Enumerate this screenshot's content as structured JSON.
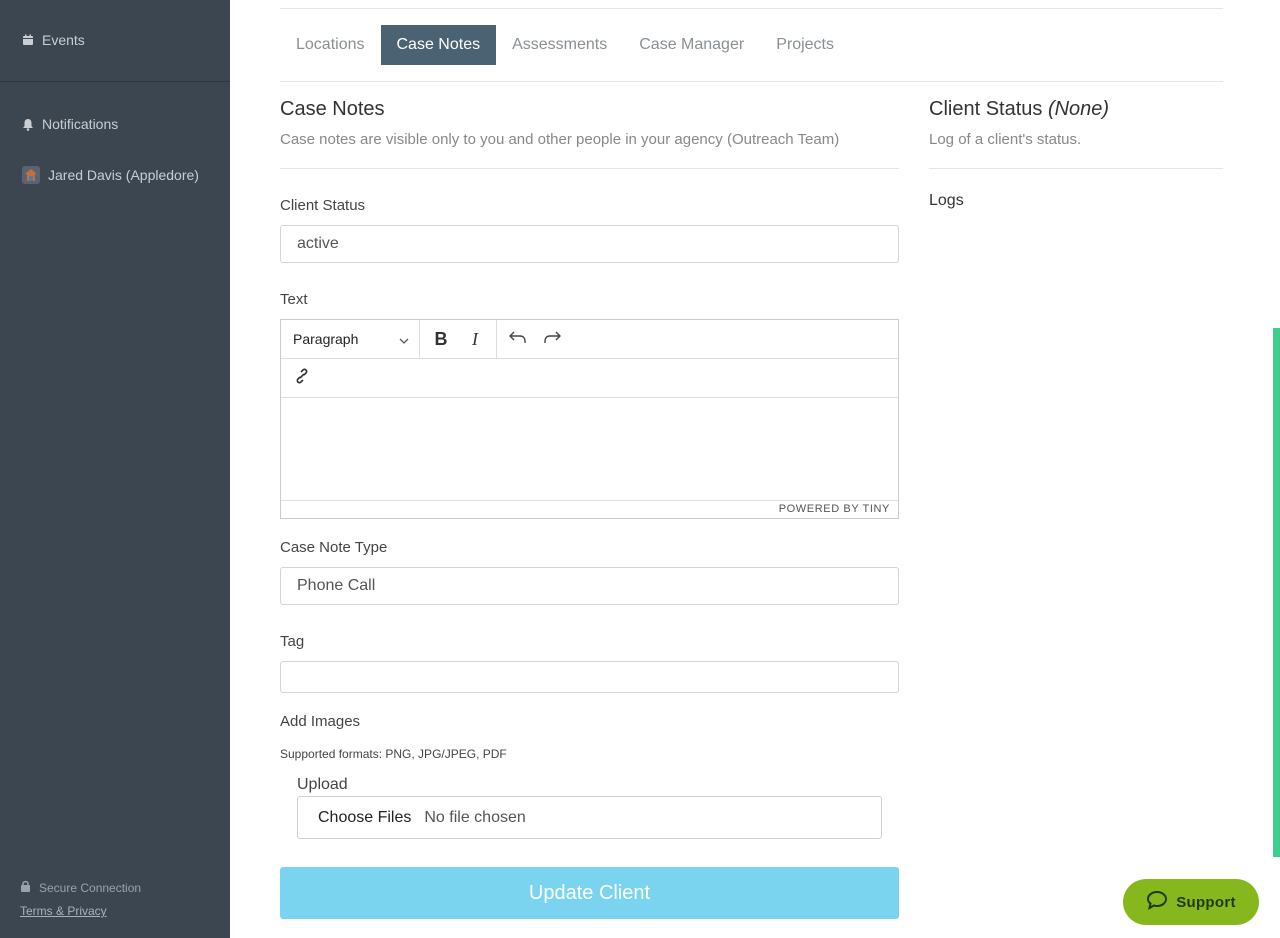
{
  "sidebar": {
    "events_label": "Events",
    "notifications_label": "Notifications",
    "user_label": "Jared Davis (Appledore)",
    "secure_label": "Secure Connection",
    "terms_label": "Terms & Privacy"
  },
  "tabs": [
    {
      "label": "Locations",
      "active": false
    },
    {
      "label": "Case Notes",
      "active": true
    },
    {
      "label": "Assessments",
      "active": false
    },
    {
      "label": "Case Manager",
      "active": false
    },
    {
      "label": "Projects",
      "active": false
    }
  ],
  "case_notes": {
    "title": "Case Notes",
    "subtitle": "Case notes are visible only to you and other people in your agency (Outreach Team)"
  },
  "client_status_panel": {
    "title": "Client Status",
    "title_suffix": "(None)",
    "subtitle": "Log of a client's status.",
    "logs_label": "Logs"
  },
  "form": {
    "client_status_label": "Client Status",
    "client_status_value": "active",
    "text_label": "Text",
    "editor": {
      "format_value": "Paragraph",
      "status_text": "POWERED BY TINY"
    },
    "case_note_type_label": "Case Note Type",
    "case_note_type_value": "Phone Call",
    "tag_label": "Tag",
    "tag_value": "",
    "add_images_label": "Add Images",
    "supported_formats": "Supported formats: PNG, JPG/JPEG, PDF",
    "upload_label": "Upload",
    "choose_files_label": "Choose Files",
    "no_file_label": "No file chosen",
    "submit_label": "Update Client"
  },
  "support_label": "Support",
  "colors": {
    "sidebar_bg": "#3c4650",
    "active_tab": "#4a6272",
    "submit_bg": "#7ad4f0",
    "support_bg": "#86b81e",
    "scroll_accent": "#3ecf8e"
  }
}
